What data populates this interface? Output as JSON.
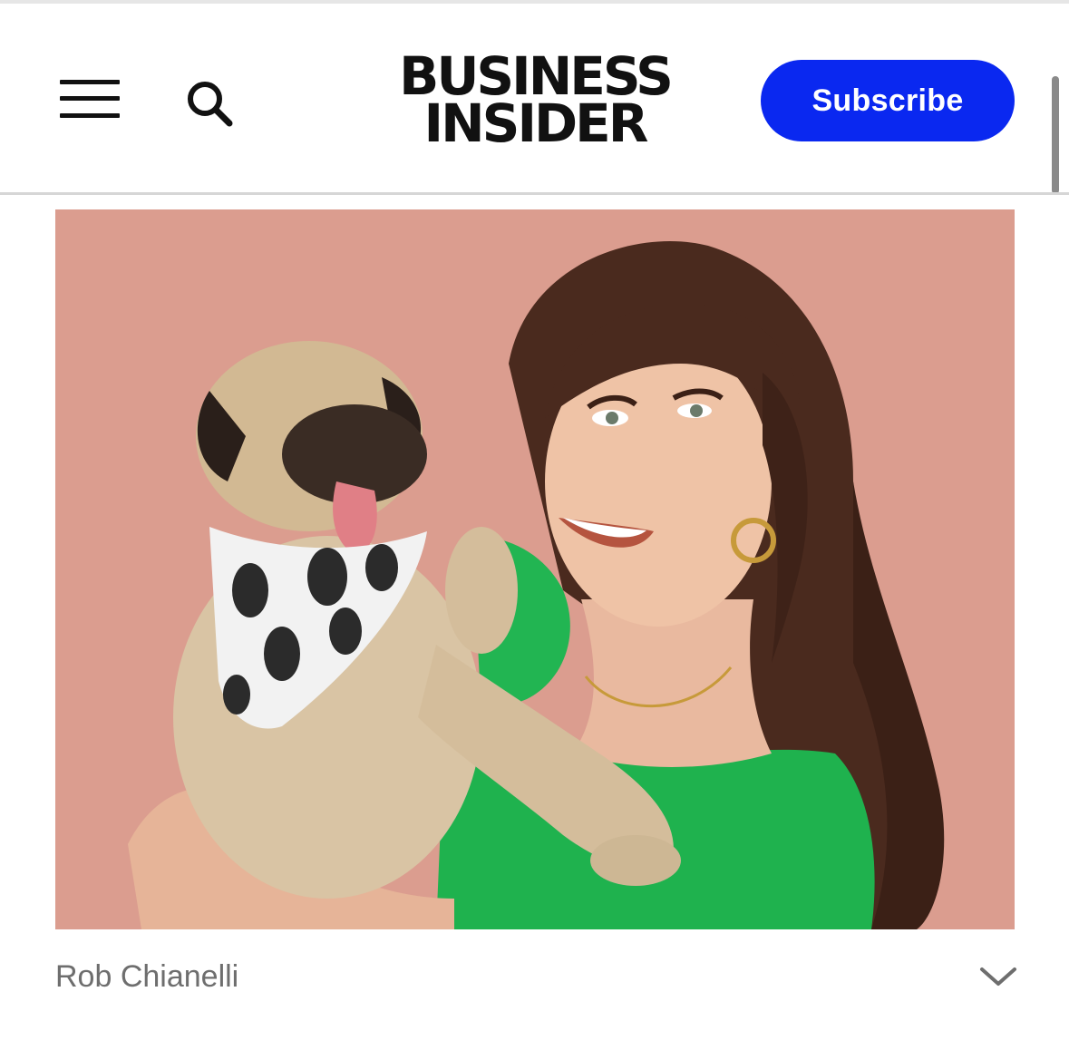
{
  "header": {
    "menu_icon": "hamburger-menu-icon",
    "search_icon": "search-icon",
    "logo": {
      "line1": "BUSINESS",
      "line2": "INSIDER"
    },
    "subscribe_label": "Subscribe"
  },
  "hero_image": {
    "caption": "Rob Chianelli",
    "expand_icon": "chevron-down-icon"
  },
  "colors": {
    "brand_blue": "#0a28f0",
    "logo_text": "#111111",
    "caption_text": "#6e6e6e"
  }
}
